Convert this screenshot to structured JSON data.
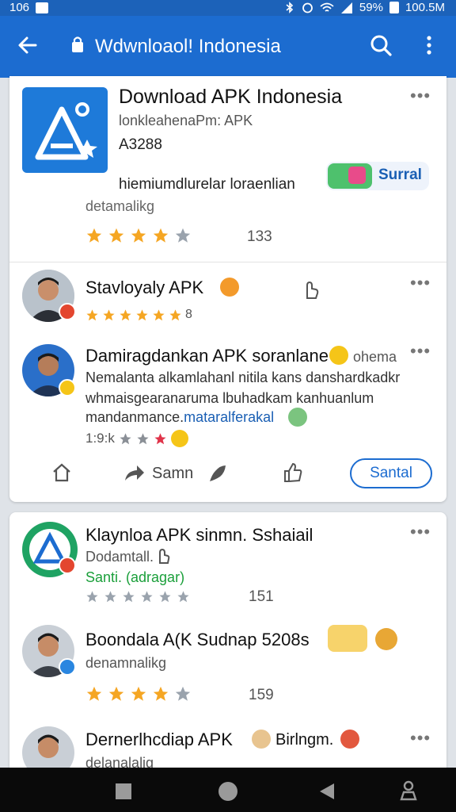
{
  "status_bar": {
    "time": "106",
    "battery": "59%",
    "data_speed": "100.5M"
  },
  "app_bar": {
    "title": "Wdwnloaol! Indonesia",
    "back_icon": "arrow-left-icon",
    "lock_icon": "lock-icon",
    "search_icon": "search-icon",
    "more_icon": "more-vert-icon"
  },
  "main_app": {
    "title": "Download APK Indonesia",
    "subtitle": "lonkleahenaPm: APK",
    "code": "A3288",
    "description": "hiemiumdlurelar loraenlian",
    "detail": "detamalikg",
    "badge_label": "Surral",
    "rating": 4,
    "rating_count": "133"
  },
  "reviews": [
    {
      "name": "Stavloyaly APK",
      "rating": 5,
      "rating_suffix": "8"
    },
    {
      "title": "Damiragdankan APK soranlane",
      "title_suffix": "ohema",
      "line1": "Nemalanta alkamlahanl nitila kans danshardkadkr",
      "line2": "whmaisgearanaruma lbuhadkam kanhuanlum",
      "line3_plain": "mandanmance.",
      "line3_link": "mataralferakal",
      "meta": "1:9:k",
      "rating": 3
    }
  ],
  "actions": {
    "share_label": "Samn",
    "primary_button": "Santal"
  },
  "second_list": [
    {
      "title": "Klaynloa APK sinmn. Sshaiail",
      "line1": "Dodamtall.",
      "line2": "Santi. (adragar)",
      "rating": 0,
      "rating_count": "151"
    },
    {
      "title": "Boondala A(K Sudnap 5208s",
      "line1": "denamnalikg",
      "rating": 4,
      "rating_count": "159"
    },
    {
      "title": "Dernerlhcdiap APK",
      "title_suffix": "Birlngm.",
      "line1": "delanalalig"
    }
  ],
  "colors": {
    "primary": "#1c6cd0",
    "star": "#f5a623",
    "link": "#1a5fb4",
    "green": "#1a9f3a"
  }
}
